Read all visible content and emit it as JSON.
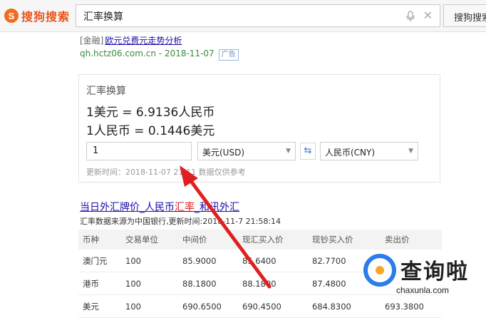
{
  "search": {
    "logo_mark": "S",
    "logo_text": "搜狗搜索",
    "query": "汇率换算",
    "button": "搜狗搜索"
  },
  "ad": {
    "tag": "[金融]",
    "link": "欧元兑费元走势分析",
    "url": "qh.hctz06.com.cn - 2018-11-07",
    "badge": "广告"
  },
  "converter": {
    "title": "汇率换算",
    "rate1": "1美元 = 6.9136人民币",
    "rate2": "1人民币 = 0.1446美元",
    "amount": "1",
    "from_currency": "美元(USD)",
    "to_currency": "人民币(CNY)",
    "update": "更新时间：2018-11-07 21:11 数据仅供参考"
  },
  "result": {
    "title_a": "当日外汇牌价_人民币",
    "title_hl": "汇率",
    "title_b": "_和讯外汇",
    "source": "汇率数据来源为中国银行,更新时间:2018-11-7 21:58:14",
    "headers": [
      "币种",
      "交易单位",
      "中间价",
      "现汇买入价",
      "现钞买入价",
      "卖出价"
    ],
    "rows": [
      [
        "澳门元",
        "100",
        "85.9000",
        "85.6400",
        "82.7700",
        ""
      ],
      [
        "港币",
        "100",
        "88.1800",
        "88.1800",
        "87.4800",
        ""
      ],
      [
        "美元",
        "100",
        "690.6500",
        "690.4500",
        "684.8300",
        "693.3800"
      ]
    ]
  },
  "watermark": {
    "text": "查询啦",
    "url": "chaxunla.com"
  },
  "colors": {
    "brand": "#f26b22",
    "link": "#1a0dab",
    "highlight": "#e02020",
    "url_green": "#3b8a3e",
    "arrow": "#e02020"
  }
}
